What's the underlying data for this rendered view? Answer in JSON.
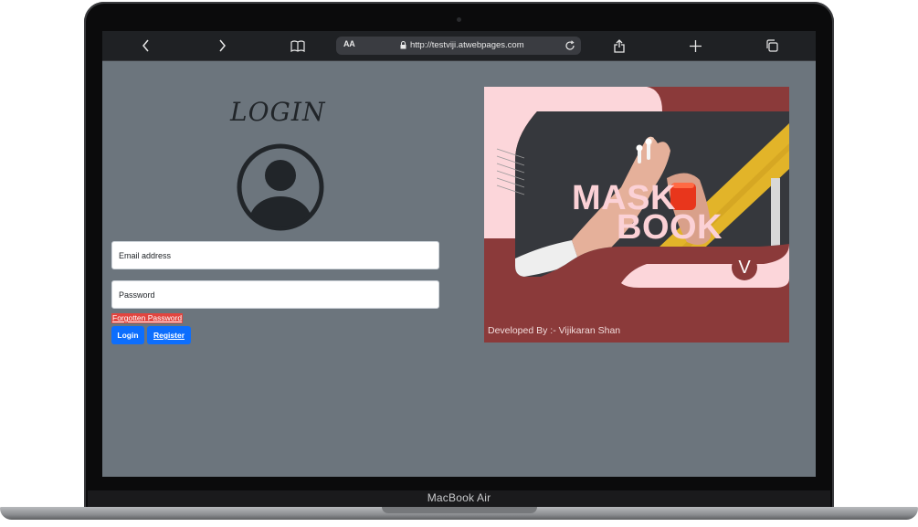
{
  "device": {
    "label": "MacBook Air"
  },
  "browser": {
    "reader_label": "AA",
    "url": "http://testviji.atwebpages.com"
  },
  "page": {
    "title": "LOGIN",
    "email_placeholder": "Email address",
    "password_placeholder": "Password",
    "forgot_link": "Forgotten Password",
    "login_button": "Login",
    "register_button": "Register"
  },
  "poster": {
    "title_line1": "MASK",
    "title_line2": "BOOK",
    "badge": "V",
    "credit": "Developed By :- Vijikaran Shan"
  },
  "colors": {
    "page_bg": "#6c757d",
    "primary": "#0d6efd",
    "danger": "#e2453f",
    "poster_maroon": "#8b3a3a",
    "poster_pink": "#fcd6da",
    "poster_title": "#fbd1d6"
  }
}
